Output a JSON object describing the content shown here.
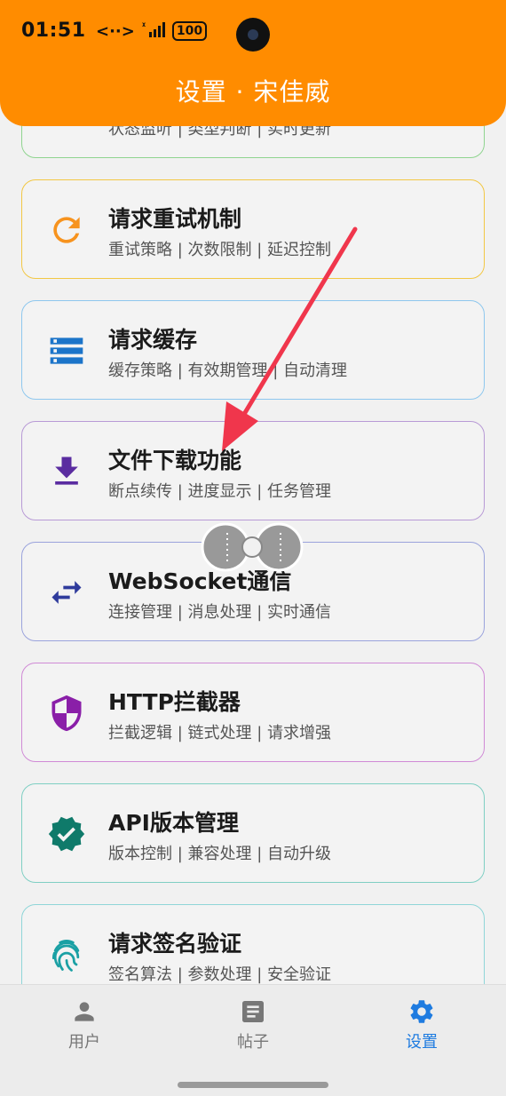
{
  "status_bar": {
    "time": "01:51",
    "battery": "100",
    "net": "<··>",
    "signal": "ᵡ"
  },
  "header": {
    "title": "设置 · 宋佳威"
  },
  "cards": [
    {
      "title": "",
      "subtitle": "状态监听 | 类型判断 | 实时更新",
      "border": "#8fd48f",
      "icon": "monitor-icon"
    },
    {
      "title": "请求重试机制",
      "subtitle": "重试策略 | 次数限制 | 延迟控制",
      "border": "#f2c744",
      "icon": "refresh-icon",
      "icon_color": "#f7931e"
    },
    {
      "title": "请求缓存",
      "subtitle": "缓存策略 | 有效期管理 | 自动清理",
      "border": "#8ec7ee",
      "icon": "storage-icon",
      "icon_color": "#1b74c9"
    },
    {
      "title": "文件下载功能",
      "subtitle": "断点续传 | 进度显示 | 任务管理",
      "border": "#b89ad6",
      "icon": "download-icon",
      "icon_color": "#5a2ca0"
    },
    {
      "title": "WebSocket通信",
      "subtitle": "连接管理 | 消息处理 | 实时通信",
      "border": "#9aa3dc",
      "icon": "swap-icon",
      "icon_color": "#2f3b9c"
    },
    {
      "title": "HTTP拦截器",
      "subtitle": "拦截逻辑 | 链式处理 | 请求增强",
      "border": "#d08ad6",
      "icon": "shield-icon",
      "icon_color": "#8a1fa8"
    },
    {
      "title": "API版本管理",
      "subtitle": "版本控制 | 兼容处理 | 自动升级",
      "border": "#7fcfc3",
      "icon": "verified-icon",
      "icon_color": "#0f7a6a"
    },
    {
      "title": "请求签名验证",
      "subtitle": "签名算法 | 参数处理 | 安全验证",
      "border": "#8fd6d8",
      "icon": "fingerprint-icon",
      "icon_color": "#1aa0a4"
    }
  ],
  "nav": [
    {
      "label": "用户",
      "icon": "person-icon",
      "active": false
    },
    {
      "label": "帖子",
      "icon": "article-icon",
      "active": false
    },
    {
      "label": "设置",
      "icon": "gear-icon",
      "active": true
    }
  ],
  "colors": {
    "accent": "#ff8c00",
    "nav_active": "#1e7be0"
  }
}
